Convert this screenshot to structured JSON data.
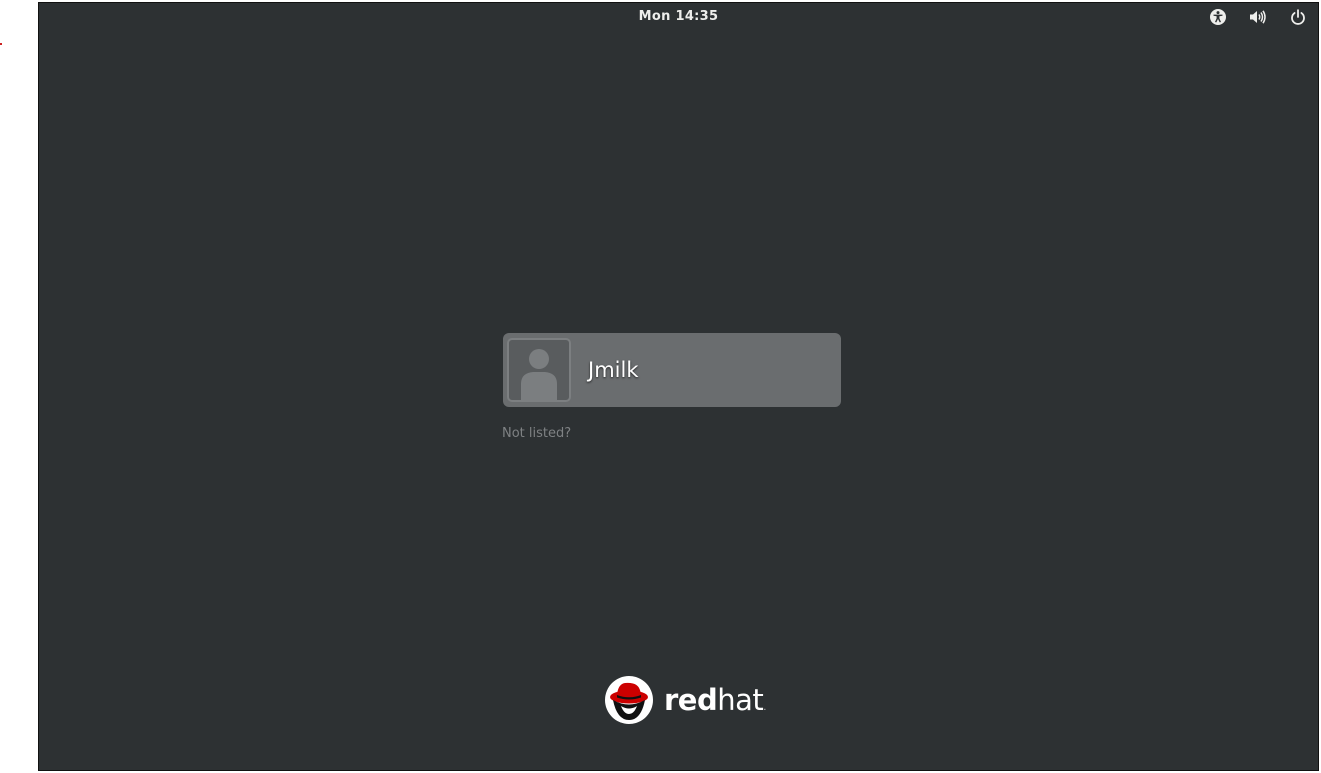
{
  "topbar": {
    "clock": "Mon 14:35",
    "icons": [
      "accessibility-icon",
      "volume-icon",
      "power-icon"
    ]
  },
  "login": {
    "users": [
      {
        "name": "Jmilk",
        "avatar_icon": "user-avatar-icon"
      }
    ],
    "not_listed_label": "Not listed?"
  },
  "branding": {
    "logo_text_bold": "red",
    "logo_text_light": "hat",
    "logo_text_suffix": ".",
    "logo_icon": "redhat-shadowman-logo"
  },
  "colors": {
    "background": "#2d3133",
    "user_card": "#6a6d6f",
    "brand_red": "#cc0000",
    "muted_text": "#7e8183"
  }
}
